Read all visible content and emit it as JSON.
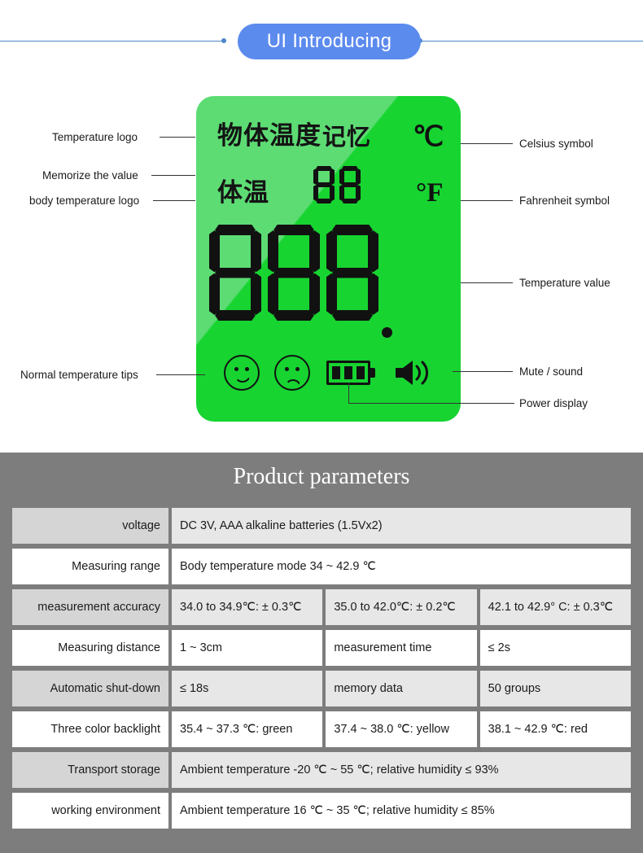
{
  "banner": {
    "title": "UI Introducing",
    "pill_color": "#5c8bee",
    "rule_color": "#4a86c8"
  },
  "lcd": {
    "background_light": "#5ddc74",
    "background_bright": "#17d431",
    "segment_color": "#111111",
    "labels": {
      "object_temperature": "物体温度",
      "memory": "记忆",
      "body_temperature": "体温",
      "celsius": "℃",
      "fahrenheit": "°F"
    },
    "memory_value": "88",
    "temperature_value": "88.8",
    "icons": {
      "happy_face": "happy-face-icon",
      "sad_face": "sad-face-icon",
      "battery": "battery-icon",
      "battery_bars": 3,
      "speaker": "speaker-icon"
    }
  },
  "callouts": {
    "left": [
      "Temperature logo",
      "Memorize the value",
      "body temperature logo",
      "Normal temperature tips"
    ],
    "right": [
      "Celsius symbol",
      "Fahrenheit symbol",
      "Temperature value",
      "Mute / sound",
      "Power display"
    ]
  },
  "params": {
    "title": "Product parameters",
    "rows": [
      {
        "shade": true,
        "cells": [
          {
            "text": "voltage",
            "span": 1,
            "label": true
          },
          {
            "text": "DC 3V, AAA alkaline batteries (1.5Vx2)",
            "span": 3,
            "label": false
          }
        ]
      },
      {
        "shade": false,
        "cells": [
          {
            "text": "Measuring range",
            "span": 1,
            "label": true
          },
          {
            "text": "Body temperature mode 34 ~ 42.9 ℃",
            "span": 3,
            "label": false
          }
        ]
      },
      {
        "shade": true,
        "cells": [
          {
            "text": "measurement accuracy",
            "span": 1,
            "label": true
          },
          {
            "text": "34.0 to 34.9℃: ± 0.3℃",
            "span": 1,
            "label": false
          },
          {
            "text": "35.0 to 42.0℃: ± 0.2℃",
            "span": 1,
            "label": false
          },
          {
            "text": "42.1 to 42.9° C: ± 0.3℃",
            "span": 1,
            "label": false
          }
        ]
      },
      {
        "shade": false,
        "cells": [
          {
            "text": "Measuring distance",
            "span": 1,
            "label": true
          },
          {
            "text": "1 ~ 3cm",
            "span": 1,
            "label": false
          },
          {
            "text": "measurement time",
            "span": 1,
            "label": false
          },
          {
            "text": "≤ 2s",
            "span": 1,
            "label": false
          }
        ]
      },
      {
        "shade": true,
        "cells": [
          {
            "text": "Automatic shut-down",
            "span": 1,
            "label": true
          },
          {
            "text": "≤ 18s",
            "span": 1,
            "label": false
          },
          {
            "text": "memory data",
            "span": 1,
            "label": false
          },
          {
            "text": "50 groups",
            "span": 1,
            "label": false
          }
        ]
      },
      {
        "shade": false,
        "cells": [
          {
            "text": "Three color backlight",
            "span": 1,
            "label": true
          },
          {
            "text": "35.4 ~ 37.3 ℃: green",
            "span": 1,
            "label": false
          },
          {
            "text": "37.4 ~ 38.0 ℃: yellow",
            "span": 1,
            "label": false
          },
          {
            "text": "38.1 ~ 42.9 ℃: red",
            "span": 1,
            "label": false
          }
        ]
      },
      {
        "shade": true,
        "cells": [
          {
            "text": "Transport storage",
            "span": 1,
            "label": true
          },
          {
            "text": "Ambient temperature -20 ℃ ~ 55 ℃;    relative humidity ≤ 93%",
            "span": 3,
            "label": false
          }
        ]
      },
      {
        "shade": false,
        "cells": [
          {
            "text": "working environment",
            "span": 1,
            "label": true
          },
          {
            "text": "Ambient temperature 16 ℃ ~ 35 ℃;    relative humidity ≤ 85%",
            "span": 3,
            "label": false
          }
        ]
      }
    ]
  }
}
